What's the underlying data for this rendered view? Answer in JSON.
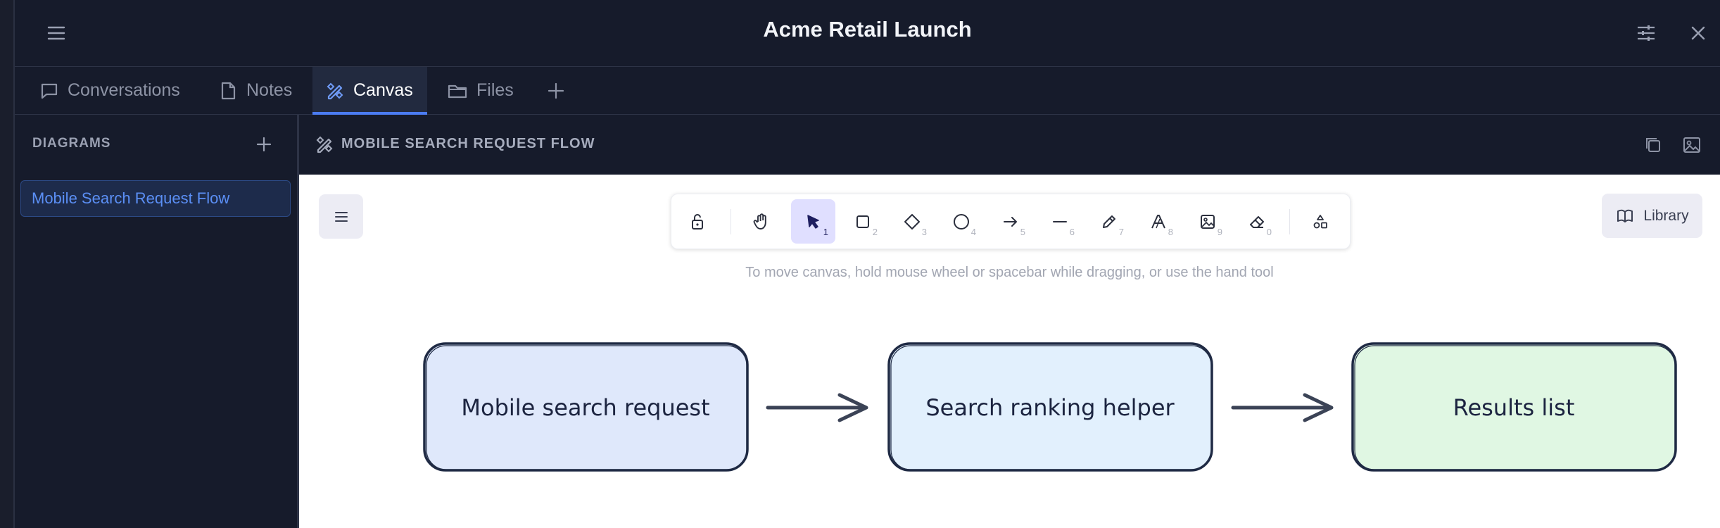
{
  "window": {
    "title": "Acme Retail Launch"
  },
  "tabs": [
    {
      "label": "Conversations",
      "icon": "chat-icon"
    },
    {
      "label": "Notes",
      "icon": "note-icon"
    },
    {
      "label": "Canvas",
      "icon": "canvas-icon",
      "active": true
    },
    {
      "label": "Files",
      "icon": "folder-icon"
    }
  ],
  "sidebar": {
    "heading": "DIAGRAMS",
    "items": [
      {
        "label": "Mobile Search Request Flow",
        "selected": true
      }
    ]
  },
  "main": {
    "title": "MOBILE SEARCH REQUEST FLOW"
  },
  "canvas": {
    "hint": "To move canvas, hold mouse wheel or spacebar while dragging, or use the hand tool",
    "library_label": "Library",
    "tools": [
      {
        "name": "lock",
        "key": ""
      },
      {
        "name": "hand",
        "key": ""
      },
      {
        "name": "selection",
        "key": "1",
        "active": true
      },
      {
        "name": "rectangle",
        "key": "2"
      },
      {
        "name": "diamond",
        "key": "3"
      },
      {
        "name": "ellipse",
        "key": "4"
      },
      {
        "name": "arrow",
        "key": "5"
      },
      {
        "name": "line",
        "key": "6"
      },
      {
        "name": "draw",
        "key": "7"
      },
      {
        "name": "text",
        "key": "8"
      },
      {
        "name": "image",
        "key": "9"
      },
      {
        "name": "eraser",
        "key": "0"
      },
      {
        "name": "more-shapes",
        "key": ""
      }
    ],
    "nodes": [
      {
        "label": "Mobile search request",
        "fill": "#dfe8fb"
      },
      {
        "label": "Search ranking helper",
        "fill": "#e2f0fd"
      },
      {
        "label": "Results list",
        "fill": "#e0f7e3"
      }
    ]
  },
  "colors": {
    "accent": "#4b7cf2",
    "stroke": "#1f2a44"
  }
}
